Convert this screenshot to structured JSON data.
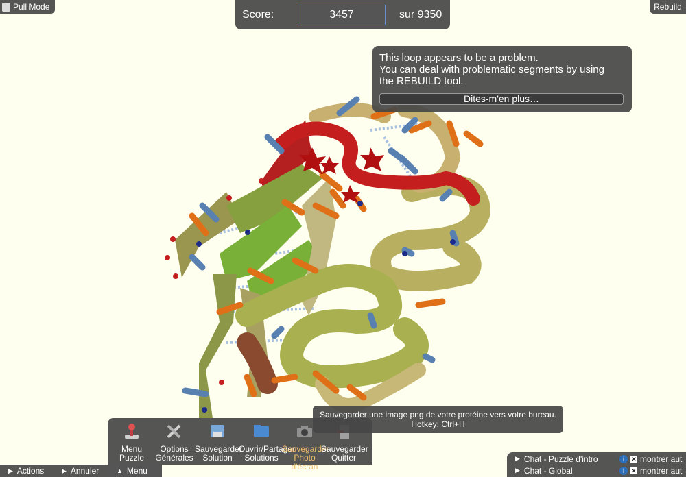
{
  "top_left": {
    "label": "Pull Mode",
    "icon": "pull-mode-icon"
  },
  "top_right": {
    "label": "Rebuild"
  },
  "score": {
    "label": "Score:",
    "value": "3457",
    "total": "sur 9350"
  },
  "tip": {
    "line1": "This loop appears to be a problem.",
    "line2": "You can deal with problematic segments by using",
    "line3": "the REBUILD tool.",
    "button": "Dites-m'en plus…"
  },
  "tooltip": {
    "line1": "Sauvegarder une image png de votre protéine vers votre bureau.",
    "line2": "Hotkey: Ctrl+H"
  },
  "toolbar": [
    {
      "l1": "Menu",
      "l2": "Puzzle",
      "icon": "joystick-icon"
    },
    {
      "l1": "Options",
      "l2": "Générales",
      "icon": "tools-icon"
    },
    {
      "l1": "Sauvegarder",
      "l2": "Solution",
      "icon": "save-icon"
    },
    {
      "l1": "Ouvrir/Partager",
      "l2": "Solutions",
      "icon": "folder-icon"
    },
    {
      "l1": "Sauvegarder",
      "l2": "Photo d'écran",
      "icon": "camera-icon"
    },
    {
      "l1": "Sauvegarder",
      "l2": "Quitter",
      "icon": "exit-icon"
    }
  ],
  "bottom_bar": {
    "actions": "Actions",
    "undo": "Annuler",
    "menu": "Menu"
  },
  "chat": {
    "row1": "Chat - Puzzle d'intro",
    "row2": "Chat - Global",
    "show1": "montrer aut",
    "show2": "montrer aut"
  },
  "colors": {
    "background": "#fffff0",
    "panel": "#464646",
    "highlight_text": "#f0c070",
    "helix": "#b8b860",
    "sheet": "#78b038",
    "problem": "#cc2222",
    "sidechain_orange": "#e07018",
    "sidechain_blue": "#5880b0"
  }
}
